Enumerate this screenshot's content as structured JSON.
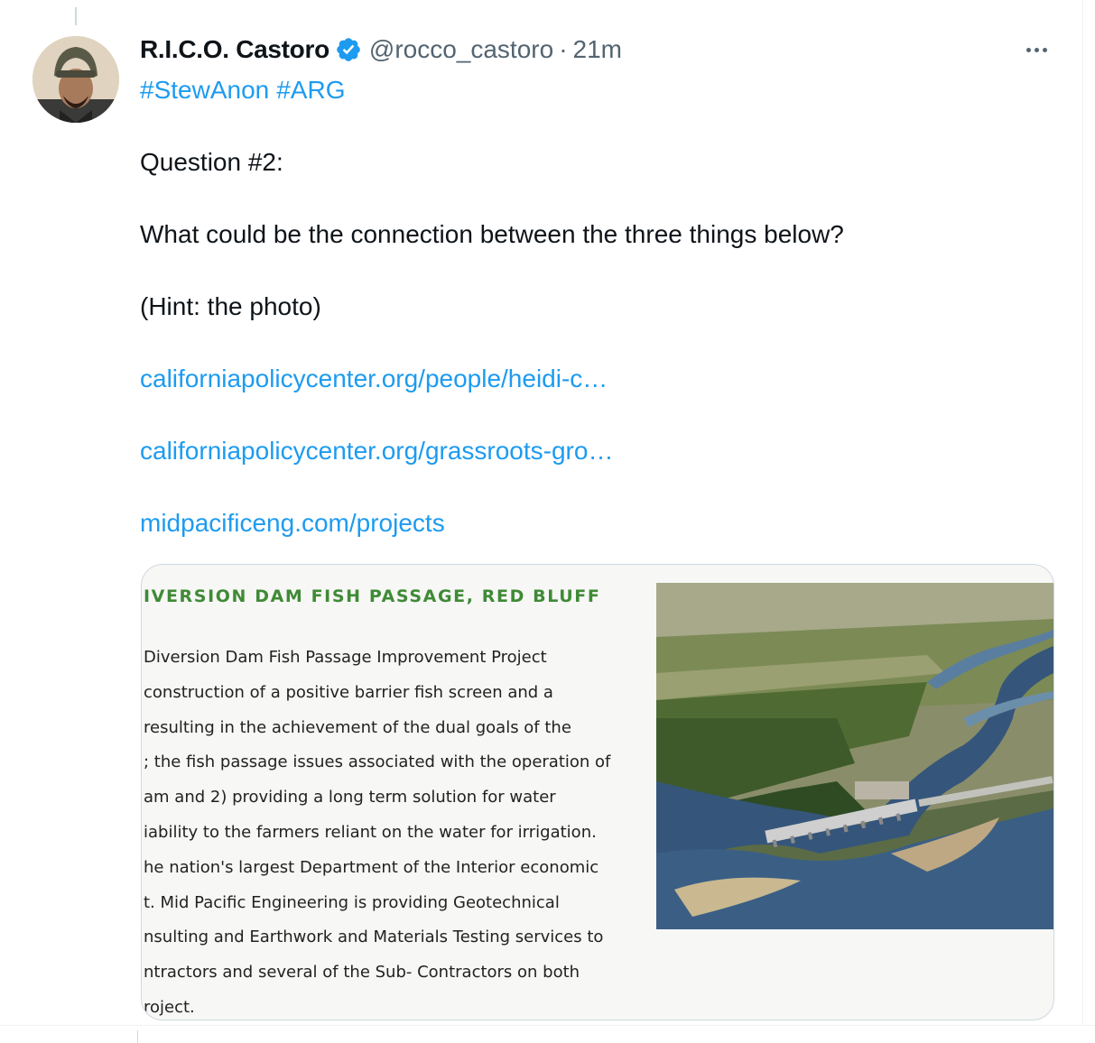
{
  "tweet": {
    "display_name": "R.I.C.O. Castoro",
    "handle": "@rocco_castoro",
    "separator": "·",
    "time": "21m",
    "hashtags": [
      "#StewAnon",
      "#ARG"
    ],
    "question": "Question #2:",
    "body": "What could be the connection between the three things below?",
    "hint": "(Hint: the photo)",
    "links": [
      "californiapolicycenter.org/people/heidi-c…",
      "californiapolicycenter.org/grassroots-gro…",
      "midpacificeng.com/projects"
    ]
  },
  "media": {
    "heading": "IVERSION DAM FISH PASSAGE, RED BLUFF",
    "lines": [
      "Diversion Dam Fish Passage Improvement Project",
      "construction of a positive barrier fish screen and a",
      " resulting in the achievement of the dual goals of the",
      "; the fish passage issues associated with the operation of",
      "am and 2) providing a long term solution for water",
      "iability to the farmers reliant on the water for irrigation.",
      "he nation's largest Department of the Interior economic",
      "t. Mid Pacific Engineering is providing Geotechnical",
      "nsulting and Earthwork and Materials Testing services to",
      "ntractors and several of the Sub- Contractors on both",
      "roject."
    ]
  },
  "colors": {
    "link": "#1d9bf0",
    "text": "#0f1419",
    "secondary": "#536471",
    "heading_green": "#3f8a36"
  },
  "icons": {
    "verified": "verified-badge-icon",
    "more": "more-options-icon"
  }
}
